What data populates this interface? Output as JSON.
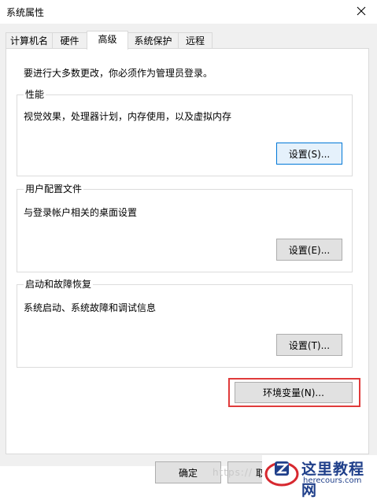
{
  "window": {
    "title": "系统属性"
  },
  "tabs": [
    {
      "label": "计算机名"
    },
    {
      "label": "硬件"
    },
    {
      "label": "高级"
    },
    {
      "label": "系统保护"
    },
    {
      "label": "远程"
    }
  ],
  "active_tab": "高级",
  "admin_note": "要进行大多数更改，你必须作为管理员登录。",
  "groups": {
    "performance": {
      "title": "性能",
      "desc": "视觉效果，处理器计划，内存使用，以及虚拟内存",
      "button": "设置(S)..."
    },
    "user_profiles": {
      "title": "用户配置文件",
      "desc": "与登录帐户相关的桌面设置",
      "button": "设置(E)..."
    },
    "startup": {
      "title": "启动和故障恢复",
      "desc": "系统启动、系统故障和调试信息",
      "button": "设置(T)..."
    }
  },
  "env_button": "环境变量(N)...",
  "footer": {
    "ok": "确定",
    "cancel": "取"
  },
  "watermark": "https://",
  "logo": {
    "title": "这里教程网",
    "subtitle": "herecours.com"
  },
  "colors": {
    "highlight": "#e03b3b",
    "focus_border": "#0078d7",
    "logo_blue": "#1f3f8a",
    "logo_red": "#d7282f"
  }
}
